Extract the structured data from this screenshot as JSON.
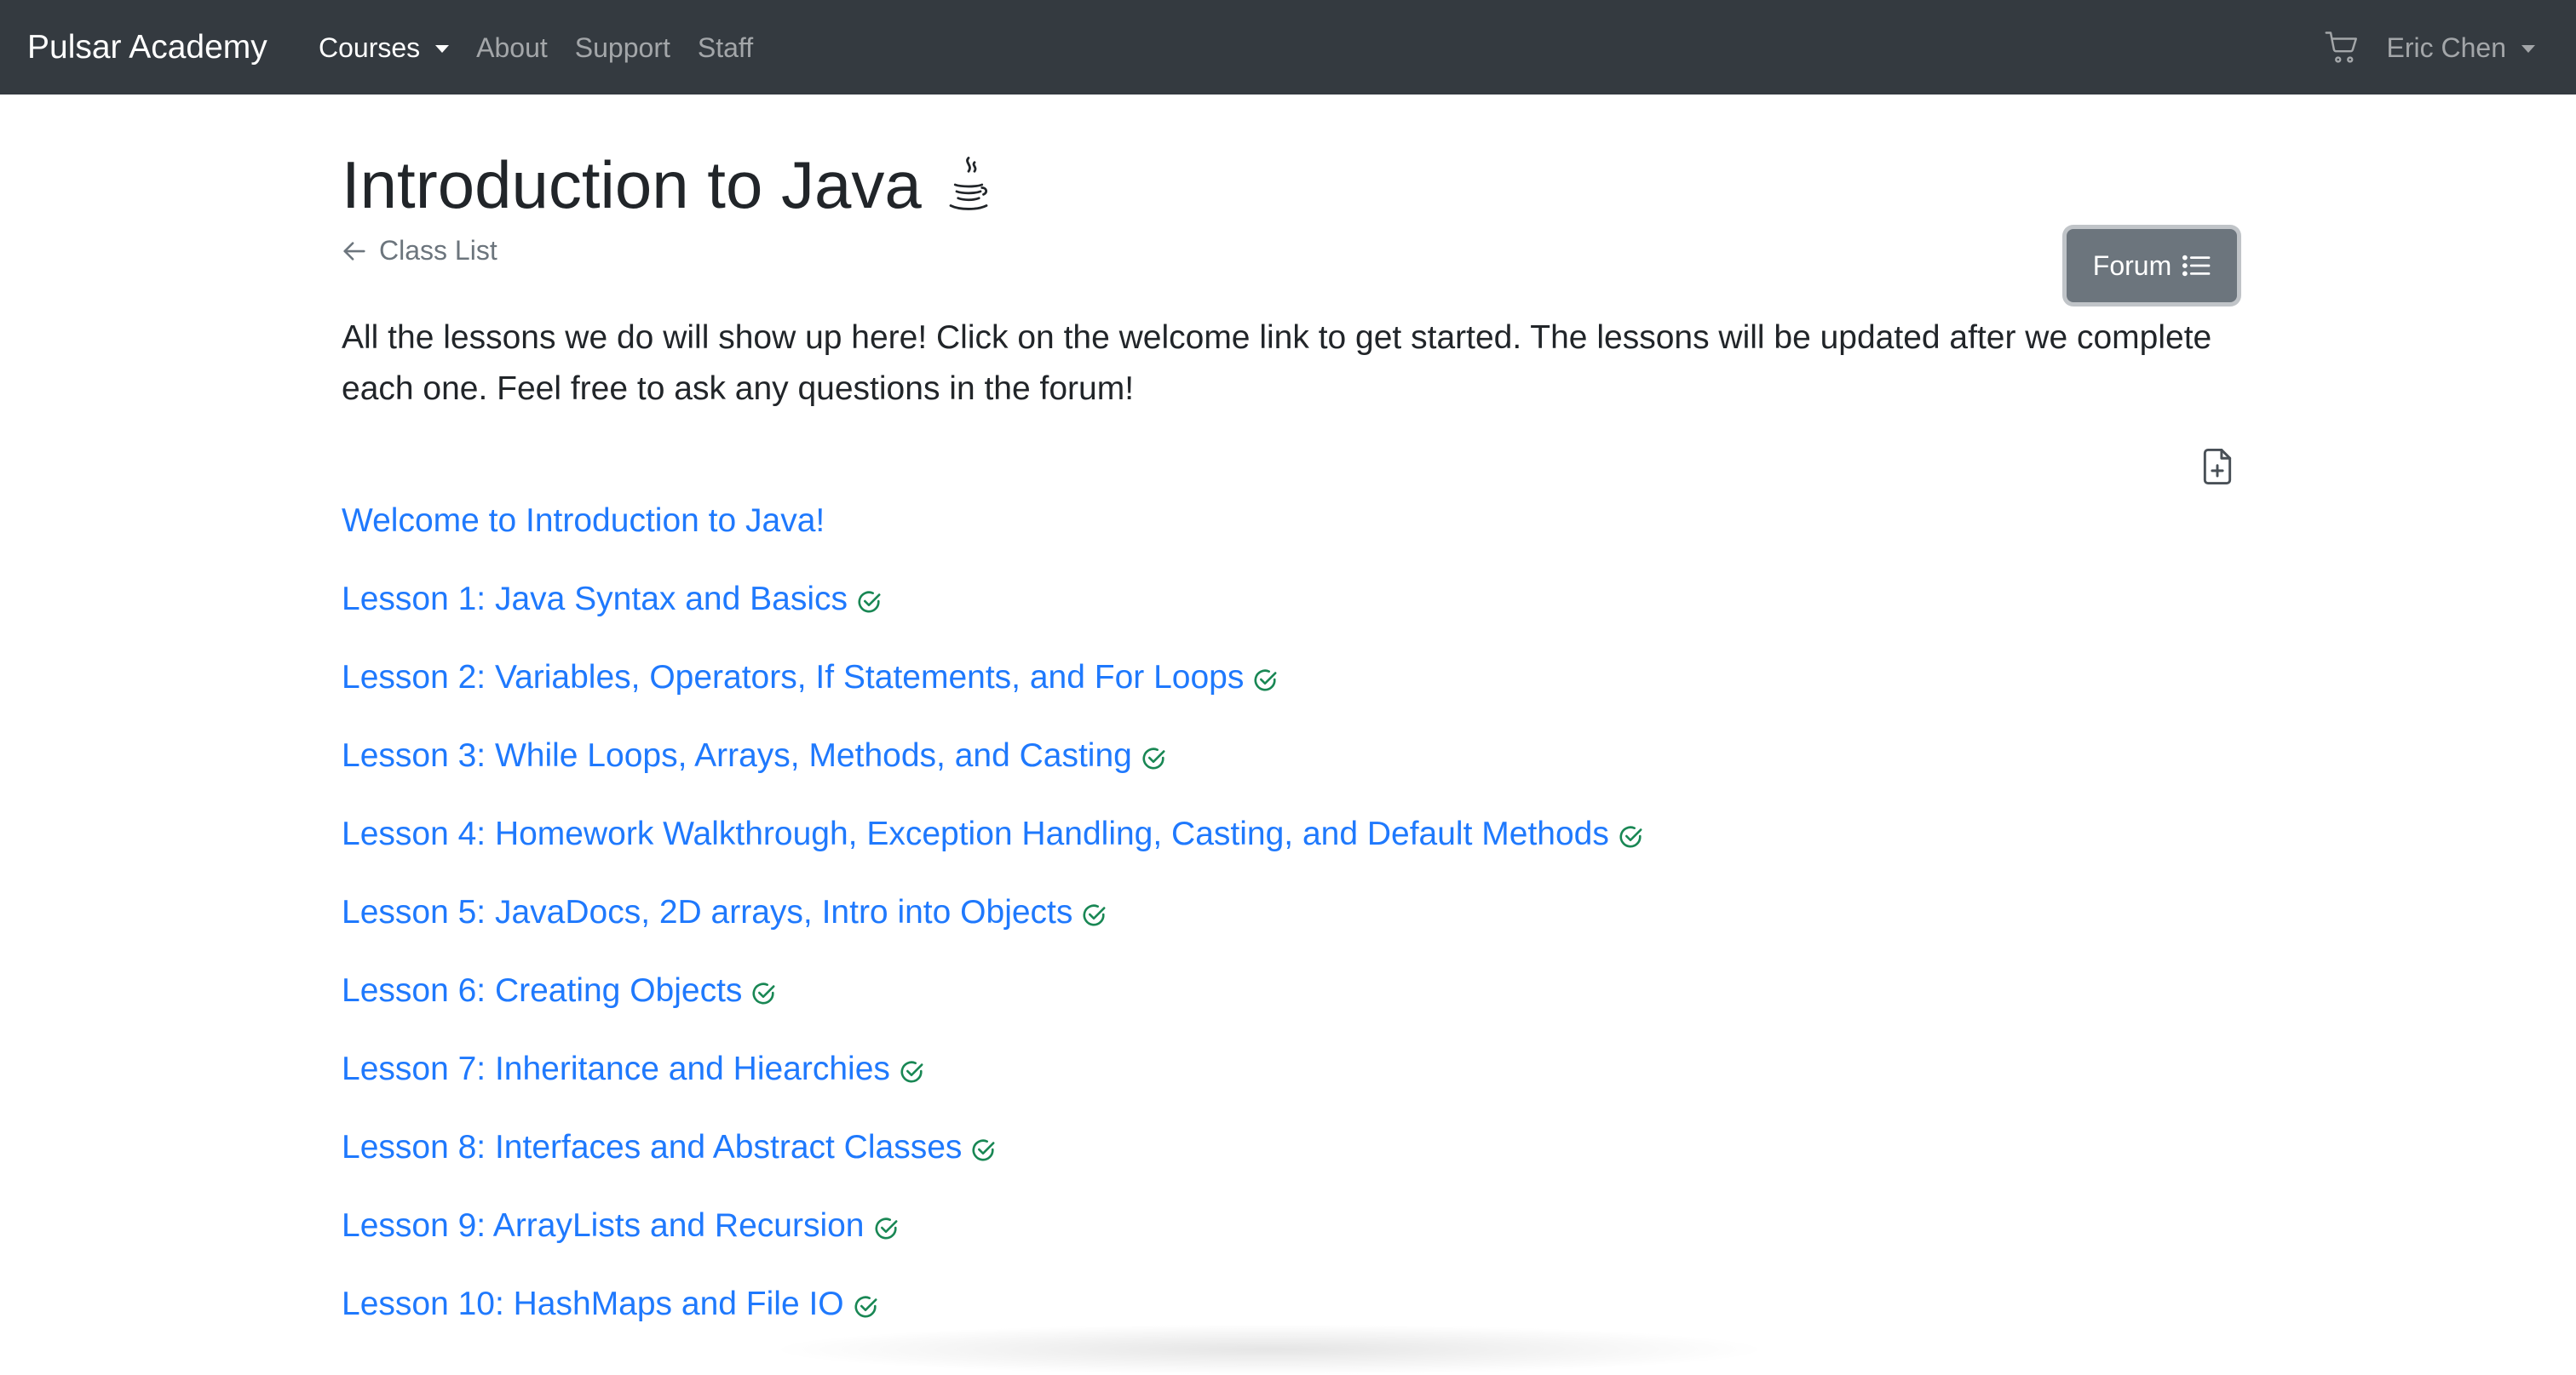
{
  "navbar": {
    "brand": "Pulsar Academy",
    "links": [
      {
        "label": "Courses",
        "active": true,
        "dropdown": true
      },
      {
        "label": "About",
        "active": false
      },
      {
        "label": "Support",
        "active": false
      },
      {
        "label": "Staff",
        "active": false
      }
    ],
    "cart_icon": "cart-icon",
    "user_name": "Eric Chen"
  },
  "page": {
    "title": "Introduction to Java",
    "title_icon": "java-cup-icon",
    "back_label": "Class List",
    "forum_label": "Forum",
    "intro": "All the lessons we do will show up here! Click on the welcome link to get started. The lessons will be updated after we complete each one. Feel free to ask any questions in the forum!",
    "add_icon": "file-plus-icon"
  },
  "lessons": [
    {
      "label": "Welcome to Introduction to Java!",
      "completed": false
    },
    {
      "label": "Lesson 1: Java Syntax and Basics",
      "completed": true
    },
    {
      "label": "Lesson 2: Variables, Operators, If Statements, and For Loops",
      "completed": true
    },
    {
      "label": "Lesson 3: While Loops, Arrays, Methods, and Casting",
      "completed": true
    },
    {
      "label": "Lesson 4: Homework Walkthrough, Exception Handling, Casting, and Default Methods",
      "completed": true
    },
    {
      "label": "Lesson 5: JavaDocs, 2D arrays, Intro into Objects",
      "completed": true
    },
    {
      "label": "Lesson 6: Creating Objects",
      "completed": true
    },
    {
      "label": "Lesson 7: Inheritance and Hiearchies",
      "completed": true
    },
    {
      "label": "Lesson 8: Interfaces and Abstract Classes",
      "completed": true
    },
    {
      "label": "Lesson 9: ArrayLists and Recursion",
      "completed": true
    },
    {
      "label": "Lesson 10: HashMaps and File IO",
      "completed": true
    }
  ],
  "colors": {
    "navbar_bg": "#343a40",
    "link": "#0d6efd",
    "check": "#198754",
    "forum_bg": "#6c757d"
  }
}
